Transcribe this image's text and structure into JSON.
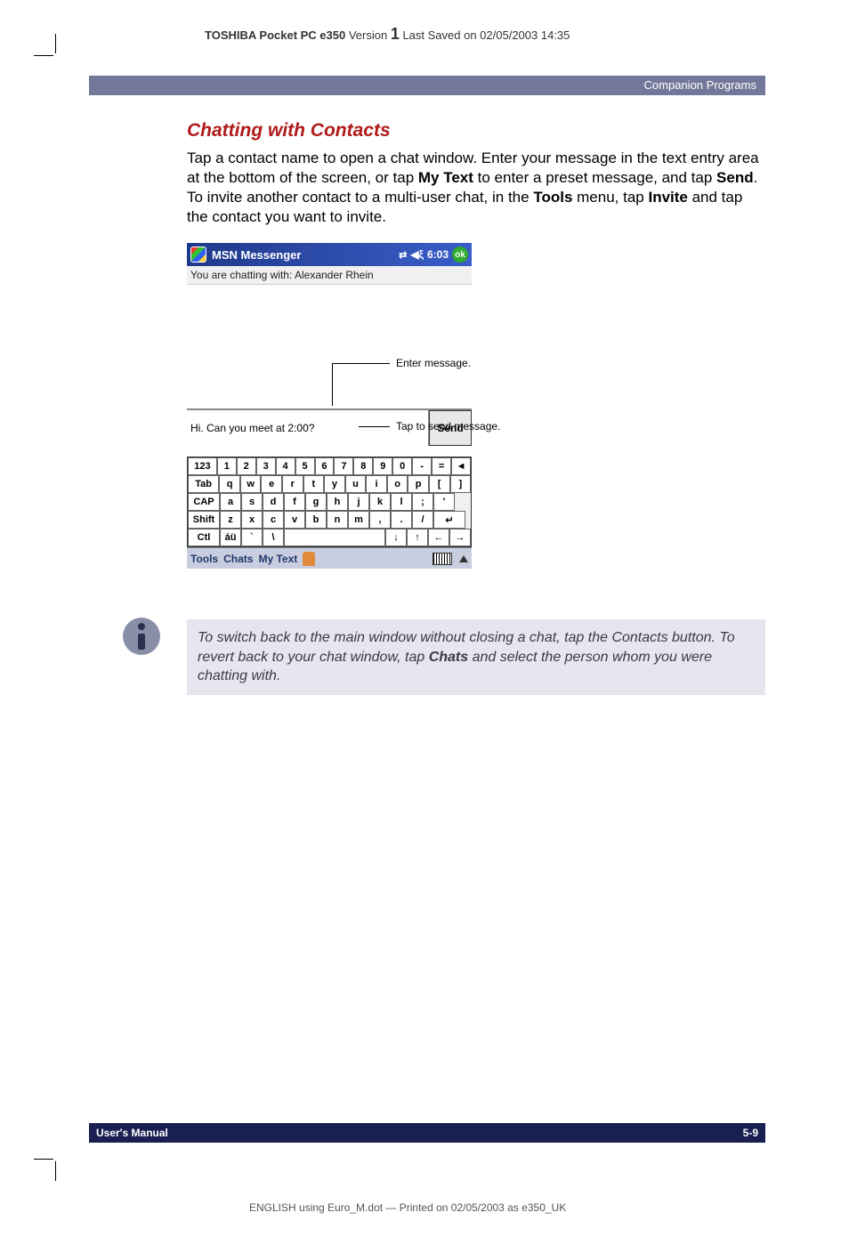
{
  "header": {
    "product_bold": "TOSHIBA Pocket PC e350",
    "version_label": " Version ",
    "version_num": "1",
    "save_note": " Last Saved on 02/05/2003 14:35"
  },
  "chapter": "Companion Programs",
  "section_title": "Chatting with Contacts",
  "body_p1_pre": "Tap a contact name to open a chat window. Enter your message in the text entry area at the bottom of the screen, or tap ",
  "body_p1_bold1": "My Text",
  "body_p1_mid1": " to enter a preset message, and tap ",
  "body_p1_bold2": "Send",
  "body_p1_mid2": ". To invite another contact to a multi-user chat, in the ",
  "body_p1_bold3": "Tools",
  "body_p1_mid3": " menu, tap ",
  "body_p1_bold4": "Invite",
  "body_p1_end": " and tap the contact you want to invite.",
  "pda": {
    "title": "MSN Messenger",
    "time": "6:03",
    "ok": "ok",
    "status": "You are chatting with: Alexander Rhein",
    "input_value": "Hi. Can you meet at 2:00?",
    "send": "Send",
    "menu_tools": "Tools",
    "menu_chats": "Chats",
    "menu_mytext": "My Text"
  },
  "keyboard": {
    "row1": [
      "123",
      "1",
      "2",
      "3",
      "4",
      "5",
      "6",
      "7",
      "8",
      "9",
      "0",
      "-",
      "=",
      "◄"
    ],
    "row2": [
      "Tab",
      "q",
      "w",
      "e",
      "r",
      "t",
      "y",
      "u",
      "i",
      "o",
      "p",
      "[",
      "]"
    ],
    "row3": [
      "CAP",
      "a",
      "s",
      "d",
      "f",
      "g",
      "h",
      "j",
      "k",
      "l",
      ";",
      "'"
    ],
    "row4": [
      "Shift",
      "z",
      "x",
      "c",
      "v",
      "b",
      "n",
      "m",
      ",",
      ".",
      "/",
      "↵"
    ],
    "row5": [
      "Ctl",
      "áü",
      "`",
      "\\",
      " ",
      "↓",
      "↑",
      "←",
      "→"
    ]
  },
  "annotations": {
    "enter": "Enter message.",
    "send_tap": "Tap to send message."
  },
  "tip_pre": "To switch back to the main window without closing a chat, tap the Contacts button. To revert back to your chat window, tap ",
  "tip_bold": "Chats",
  "tip_end": " and select the person whom you were chatting with.",
  "footer": {
    "left": "User's Manual",
    "right": "5-9"
  },
  "print_line": "ENGLISH using Euro_M.dot — Printed on 02/05/2003 as e350_UK"
}
